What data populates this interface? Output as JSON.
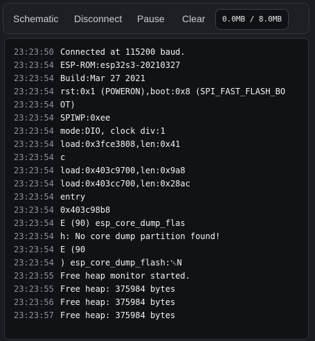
{
  "toolbar": {
    "schematic": "Schematic",
    "disconnect": "Disconnect",
    "pause": "Pause",
    "clear": "Clear",
    "buffer": "0.0MB / 8.0MB"
  },
  "log": [
    {
      "ts": "23:23:50",
      "msg": "Connected at 115200 baud."
    },
    {
      "ts": "23:23:54",
      "msg": "ESP-ROM:esp32s3-20210327"
    },
    {
      "ts": "23:23:54",
      "msg": "Build:Mar 27 2021"
    },
    {
      "ts": "23:23:54",
      "msg": "rst:0x1 (POWERON),boot:0x8 (SPI_FAST_FLASH_BO"
    },
    {
      "ts": "23:23:54",
      "msg": "OT)"
    },
    {
      "ts": "23:23:54",
      "msg": "SPIWP:0xee"
    },
    {
      "ts": "23:23:54",
      "msg": "mode:DIO, clock div:1"
    },
    {
      "ts": "23:23:54",
      "msg": "load:0x3fce3808,len:0x41"
    },
    {
      "ts": "23:23:54",
      "msg": "c"
    },
    {
      "ts": "23:23:54",
      "msg": "load:0x403c9700,len:0x9a8"
    },
    {
      "ts": "23:23:54",
      "msg": "load:0x403cc700,len:0x28ac"
    },
    {
      "ts": "23:23:54",
      "msg": "entry"
    },
    {
      "ts": "23:23:54",
      "msg": "0x403c98b8"
    },
    {
      "ts": "23:23:54",
      "msg": "E (90) esp_core_dump_flas"
    },
    {
      "ts": "23:23:54",
      "msg": "h: No core dump partition found!"
    },
    {
      "ts": "23:23:54",
      "msg": "E (90"
    },
    {
      "ts": "23:23:54",
      "msg": ") esp_core_dump_flash:␛N"
    },
    {
      "ts": "23:23:55",
      "msg": "Free heap monitor started."
    },
    {
      "ts": "23:23:55",
      "msg": "Free heap: 375984 bytes"
    },
    {
      "ts": "23:23:56",
      "msg": "Free heap: 375984 bytes"
    },
    {
      "ts": "23:23:57",
      "msg": "Free heap: 375984 bytes"
    }
  ]
}
